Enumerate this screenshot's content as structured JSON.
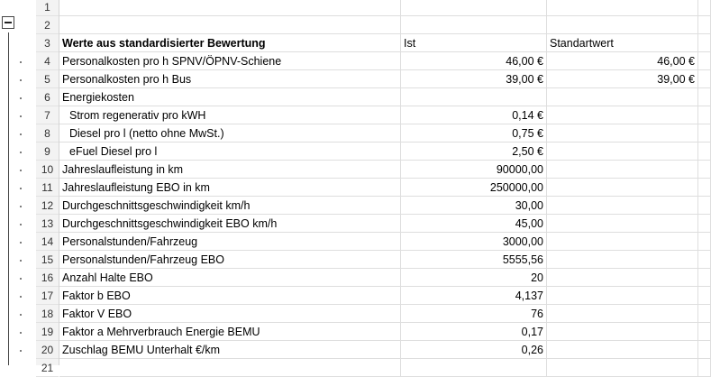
{
  "rows": [
    {
      "num": "1",
      "a": "",
      "b": "",
      "c": ""
    },
    {
      "num": "2",
      "a": "",
      "b": "",
      "c": ""
    },
    {
      "num": "3",
      "a": "Werte aus standardisierter Bewertung",
      "b": "Ist",
      "c": "Standartwert"
    },
    {
      "num": "4",
      "a": "Personalkosten pro h SPNV/ÖPNV-Schiene",
      "b": "46,00 €",
      "c": "46,00 €"
    },
    {
      "num": "5",
      "a": "Personalkosten pro h Bus",
      "b": "39,00 €",
      "c": "39,00 €"
    },
    {
      "num": "6",
      "a": "Energiekosten",
      "b": "",
      "c": ""
    },
    {
      "num": "7",
      "a": "Strom regenerativ pro kWH",
      "b": "0,14 €",
      "c": ""
    },
    {
      "num": "8",
      "a": "Diesel pro l (netto ohne MwSt.)",
      "b": "0,75 €",
      "c": ""
    },
    {
      "num": "9",
      "a": "eFuel Diesel pro l",
      "b": "2,50 €",
      "c": ""
    },
    {
      "num": "10",
      "a": "Jahreslaufleistung in km",
      "b": "90000,00",
      "c": ""
    },
    {
      "num": "11",
      "a": "Jahreslaufleistung EBO in km",
      "b": "250000,00",
      "c": ""
    },
    {
      "num": "12",
      "a": "Durchgeschnittsgeschwindigkeit km/h",
      "b": "30,00",
      "c": ""
    },
    {
      "num": "13",
      "a": "Durchgeschnittsgeschwindigkeit EBO km/h",
      "b": "45,00",
      "c": ""
    },
    {
      "num": "14",
      "a": "Personalstunden/Fahrzeug",
      "b": "3000,00",
      "c": ""
    },
    {
      "num": "15",
      "a": "Personalstunden/Fahrzeug EBO",
      "b": "5555,56",
      "c": ""
    },
    {
      "num": "16",
      "a": "Anzahl Halte EBO",
      "b": "20",
      "c": ""
    },
    {
      "num": "17",
      "a": "Faktor b EBO",
      "b": "4,137",
      "c": ""
    },
    {
      "num": "18",
      "a": "Faktor V EBO",
      "b": "76",
      "c": ""
    },
    {
      "num": "19",
      "a": "Faktor a Mehrverbrauch Energie BEMU",
      "b": "0,17",
      "c": ""
    },
    {
      "num": "20",
      "a": "Zuschlag BEMU Unterhalt €/km",
      "b": "0,26",
      "c": ""
    },
    {
      "num": "21",
      "a": "",
      "b": "",
      "c": ""
    }
  ]
}
